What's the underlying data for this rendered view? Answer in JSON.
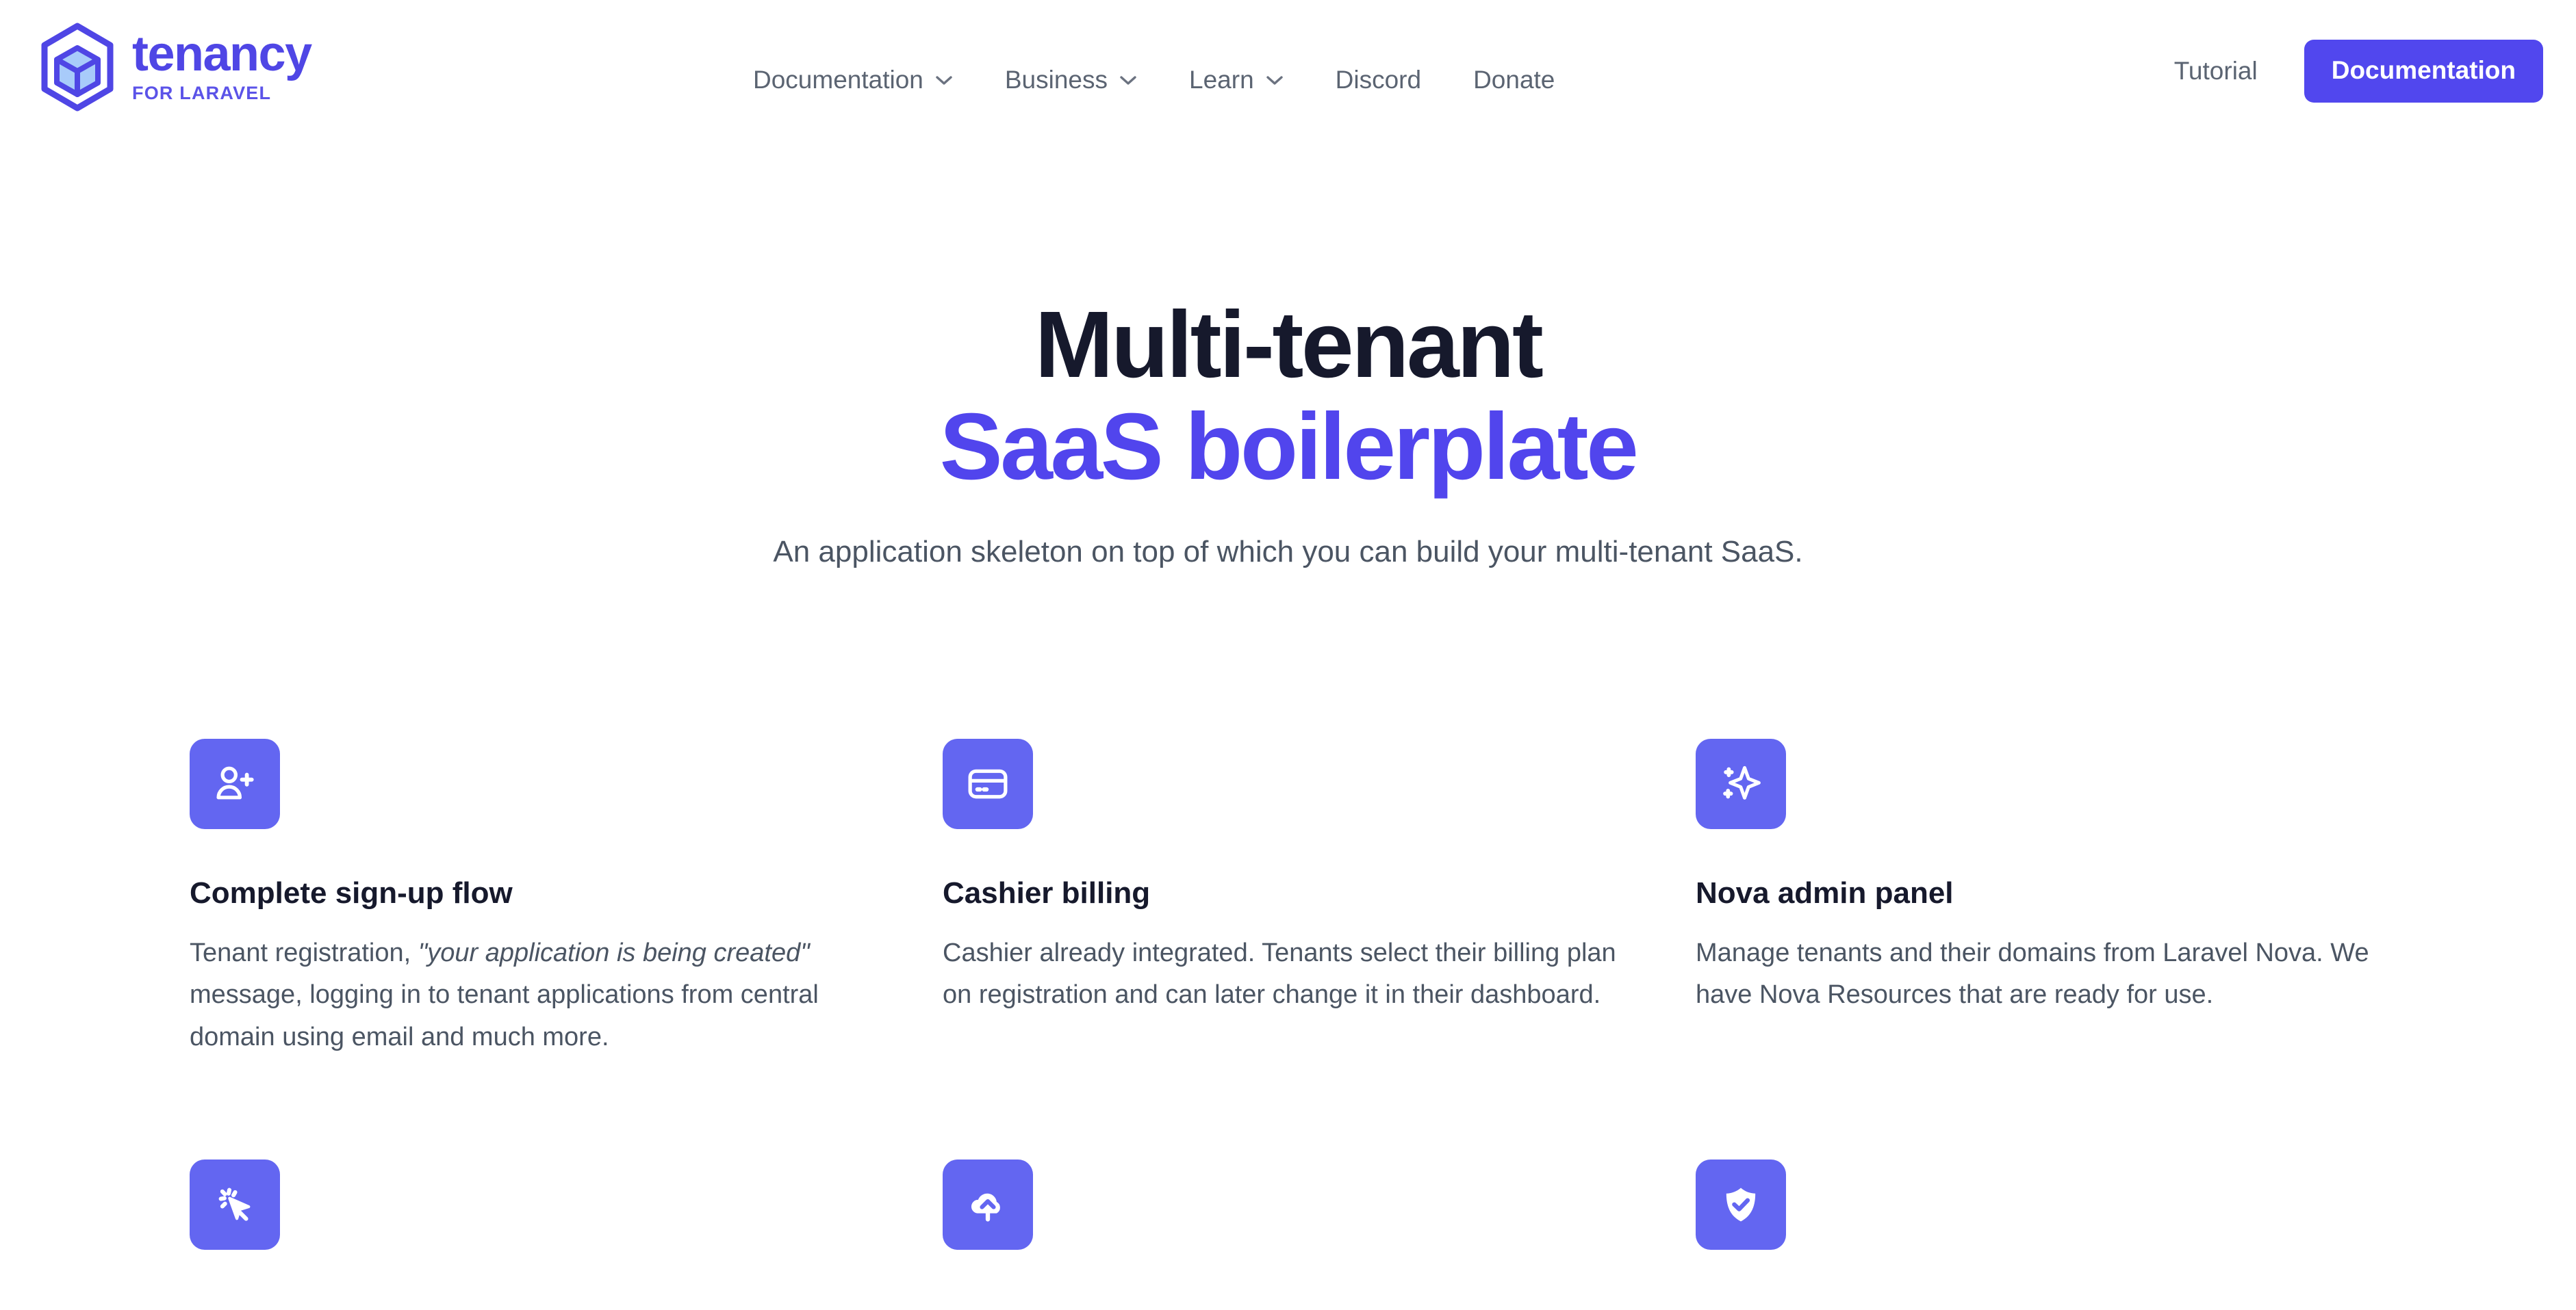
{
  "brand": {
    "name": "tenancy",
    "tagline": "FOR LARAVEL",
    "logo_icon": "hexagon-cube-icon"
  },
  "colors": {
    "brand_purple": "#4F46E5",
    "cta_purple": "#5147EE",
    "icon_tile_purple": "#6366F1",
    "heading_dark": "#16192C",
    "heading_purple": "#5145ED",
    "body_gray": "#4b5563",
    "nav_gray": "#5b6472",
    "logo_cube_fill": "#A8CBFA",
    "page_background": "#ffffff"
  },
  "nav": {
    "items": [
      {
        "label": "Documentation",
        "has_dropdown": true,
        "icon": "chevron-down-icon"
      },
      {
        "label": "Business",
        "has_dropdown": true,
        "icon": "chevron-down-icon"
      },
      {
        "label": "Learn",
        "has_dropdown": true,
        "icon": "chevron-down-icon"
      },
      {
        "label": "Discord",
        "has_dropdown": false
      },
      {
        "label": "Donate",
        "has_dropdown": false
      }
    ],
    "tutorial_label": "Tutorial",
    "cta_label": "Documentation"
  },
  "hero": {
    "title_line1": "Multi-tenant",
    "title_line2": "SaaS boilerplate",
    "subtitle": "An application skeleton on top of which you can build your multi-tenant SaaS."
  },
  "features": [
    {
      "icon": "user-plus-icon",
      "title": "Complete sign-up flow",
      "desc_part1": "Tenant registration, ",
      "desc_quote": "\"your application is being created\"",
      "desc_part2": " message, logging in to tenant applications from central domain using email and much more."
    },
    {
      "icon": "credit-card-icon",
      "title": "Cashier billing",
      "desc_part1": "Cashier already integrated. Tenants select their billing plan on registration and can later change it in their dashboard.",
      "desc_quote": "",
      "desc_part2": ""
    },
    {
      "icon": "sparkles-icon",
      "title": "Nova admin panel",
      "desc_part1": "Manage tenants and their domains from Laravel Nova. We have Nova Resources that are ready for use.",
      "desc_quote": "",
      "desc_part2": ""
    },
    {
      "icon": "cursor-click-icon",
      "title": "",
      "desc_part1": "",
      "desc_quote": "",
      "desc_part2": ""
    },
    {
      "icon": "cloud-upload-icon",
      "title": "",
      "desc_part1": "",
      "desc_quote": "",
      "desc_part2": ""
    },
    {
      "icon": "shield-check-icon",
      "title": "",
      "desc_part1": "",
      "desc_quote": "",
      "desc_part2": ""
    }
  ]
}
